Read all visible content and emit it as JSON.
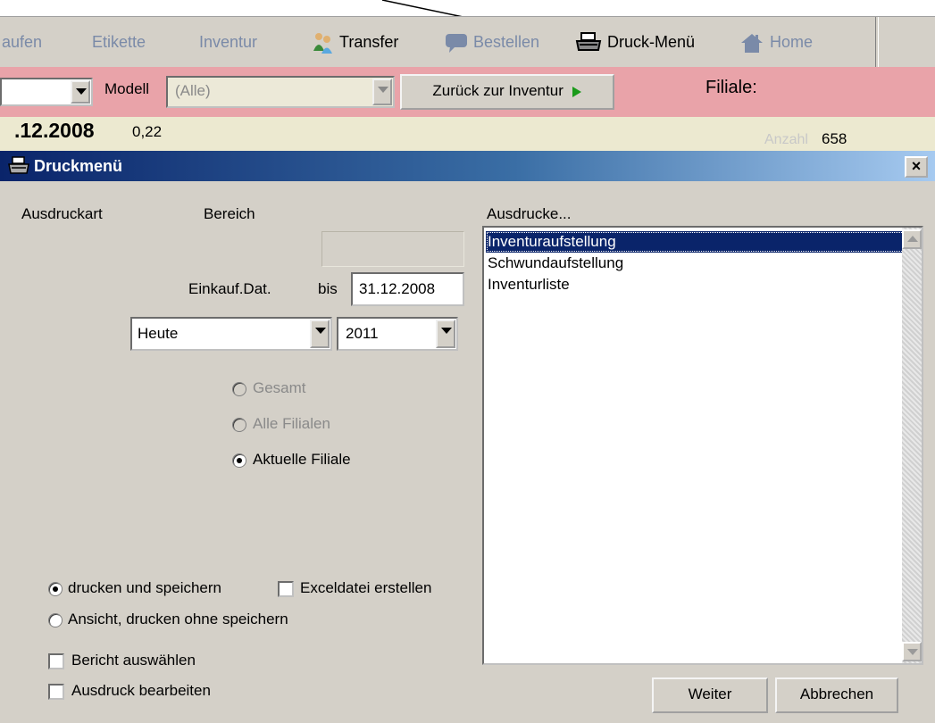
{
  "toolbar": {
    "items": [
      {
        "label": "aufen",
        "icon": ""
      },
      {
        "label": "Etikette",
        "icon": ""
      },
      {
        "label": "Inventur",
        "icon": ""
      },
      {
        "label": "Transfer",
        "icon": "transfer-icon"
      },
      {
        "label": "Bestellen",
        "icon": "chat-icon"
      },
      {
        "label": "Druck-Menü",
        "icon": "printer-icon"
      },
      {
        "label": "Home",
        "icon": "home-icon"
      }
    ]
  },
  "filterbar": {
    "model_label": "Modell",
    "model_value": "(Alle)",
    "back_button": "Zurück zur Inventur",
    "branch_label": "Filiale:"
  },
  "infostrip": {
    "date_text": ".12.2008",
    "value_text": "0,22",
    "count_label": "Anzahl",
    "count_value": "658"
  },
  "dialog": {
    "title": "Druckmenü",
    "close_label": "×",
    "print_type_label": "Ausdruckart",
    "range_label": "Bereich",
    "purchase_date_label": "Einkauf.Dat.",
    "to_label": "bis",
    "to_date": "31.12.2008",
    "period_value": "Heute",
    "year_value": "2011",
    "scope_options": [
      "Gesamt",
      "Alle Filialen",
      "Aktuelle Filiale"
    ],
    "output_options": [
      "drucken und speichern",
      "Ansicht, drucken ohne speichern"
    ],
    "excel_label": "Exceldatei erstellen",
    "select_report_label": "Bericht auswählen",
    "edit_print_label": "Ausdruck bearbeiten",
    "reports_label": "Ausdrucke...",
    "reports": [
      "Inventuraufstellung",
      "Schwundaufstellung",
      "Inventurliste"
    ],
    "next_button": "Weiter",
    "cancel_button": "Abbrechen"
  },
  "colors": {
    "filterbar_bg": "#e9a3a9",
    "titlebar_start": "#0a246a",
    "selection": "#0a246a"
  }
}
